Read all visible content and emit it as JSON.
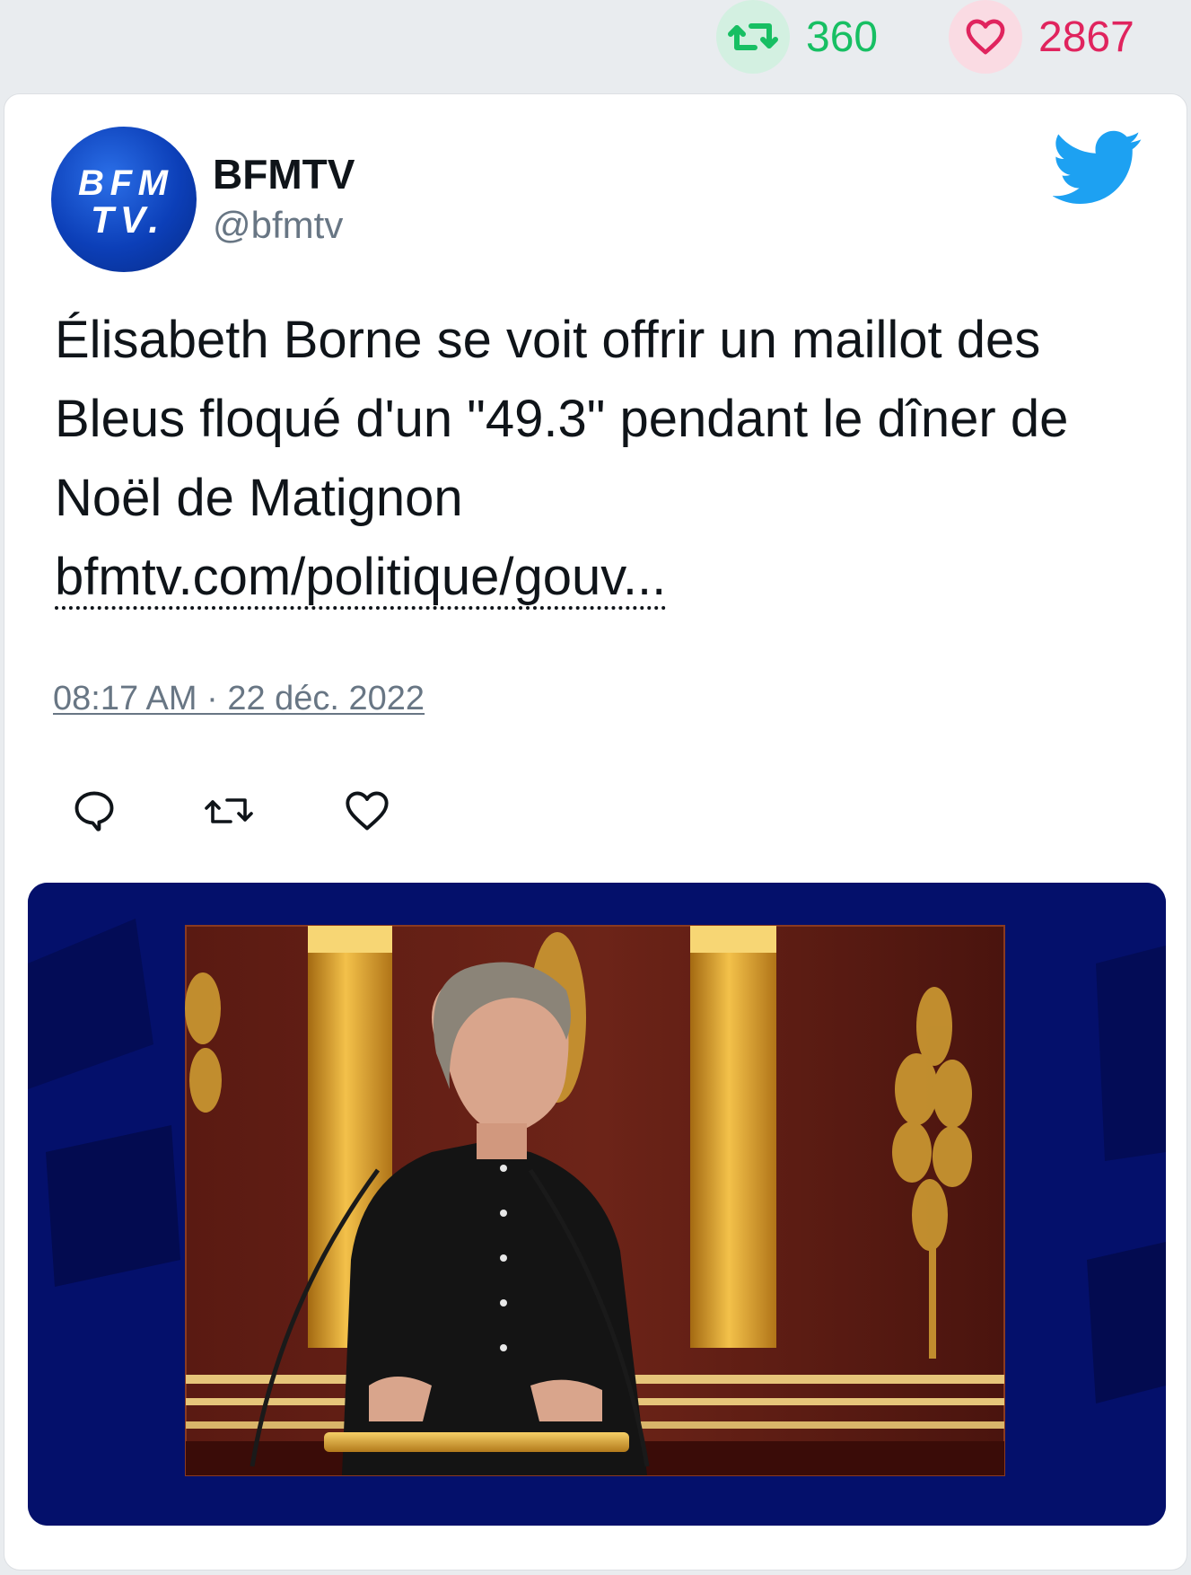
{
  "stats": {
    "retweets": "360",
    "likes": "2867",
    "retweet_icon": "retweet-icon",
    "like_icon": "heart-icon",
    "retweet_color": "#17bf63",
    "like_color": "#e0245e"
  },
  "tweet": {
    "author_name": "BFMTV",
    "author_handle": "@bfmtv",
    "avatar_line1": "BFM",
    "avatar_line2": "TV.",
    "text": "Élisabeth Borne se voit offrir un maillot des Bleus floqué d'un \"49.3\" pendant le dîner de Noël de Matignon",
    "link": "bfmtv.com/politique/gouv...",
    "timestamp": "08:17 AM · 22 déc. 2022",
    "brand_icon": "twitter-bird-icon",
    "brand_color": "#1da1f2"
  },
  "actions": [
    {
      "icon": "reply-icon"
    },
    {
      "icon": "retweet-icon"
    },
    {
      "icon": "like-icon"
    }
  ],
  "media": {
    "type": "video-thumbnail",
    "frame_color": "#04106b"
  }
}
